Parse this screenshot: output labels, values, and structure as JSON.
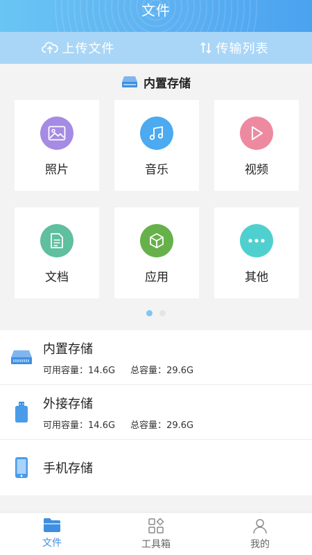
{
  "header": {
    "title": "文件"
  },
  "actions": {
    "upload": {
      "label": "上传文件",
      "icon": "cloud-upload-icon"
    },
    "transfer": {
      "label": "传输列表",
      "icon": "transfer-arrows-icon"
    }
  },
  "section": {
    "title": "内置存储",
    "icon": "storage-drive-icon"
  },
  "categories": [
    {
      "label": "照片",
      "icon": "image-icon",
      "color": "#a58be3"
    },
    {
      "label": "音乐",
      "icon": "music-note-icon",
      "color": "#4baaf0"
    },
    {
      "label": "视频",
      "icon": "play-icon",
      "color": "#ee8aa0"
    },
    {
      "label": "文档",
      "icon": "document-icon",
      "color": "#5fbf9e"
    },
    {
      "label": "应用",
      "icon": "cube-icon",
      "color": "#66b14a"
    },
    {
      "label": "其他",
      "icon": "more-dots-icon",
      "color": "#4fd0cf"
    }
  ],
  "pager": {
    "pages": 2,
    "current": 1
  },
  "storage": [
    {
      "name": "内置存储",
      "icon": "storage-drive-icon",
      "available_label": "可用容量：",
      "available": "14.6G",
      "total_label": "总容量：",
      "total": "29.6G"
    },
    {
      "name": "外接存储",
      "icon": "usb-drive-icon",
      "available_label": "可用容量：",
      "available": "14.6G",
      "total_label": "总容量：",
      "total": "29.6G"
    },
    {
      "name": "手机存储",
      "icon": "phone-icon"
    }
  ],
  "nav": [
    {
      "label": "文件",
      "icon": "folder-icon",
      "active": true
    },
    {
      "label": "工具箱",
      "icon": "toolbox-grid-icon",
      "active": false
    },
    {
      "label": "我的",
      "icon": "user-icon",
      "active": false
    }
  ],
  "colors": {
    "accent": "#4aa3f0",
    "action_bar": "#a9d6f6",
    "nav_active": "#3f8fe0"
  }
}
